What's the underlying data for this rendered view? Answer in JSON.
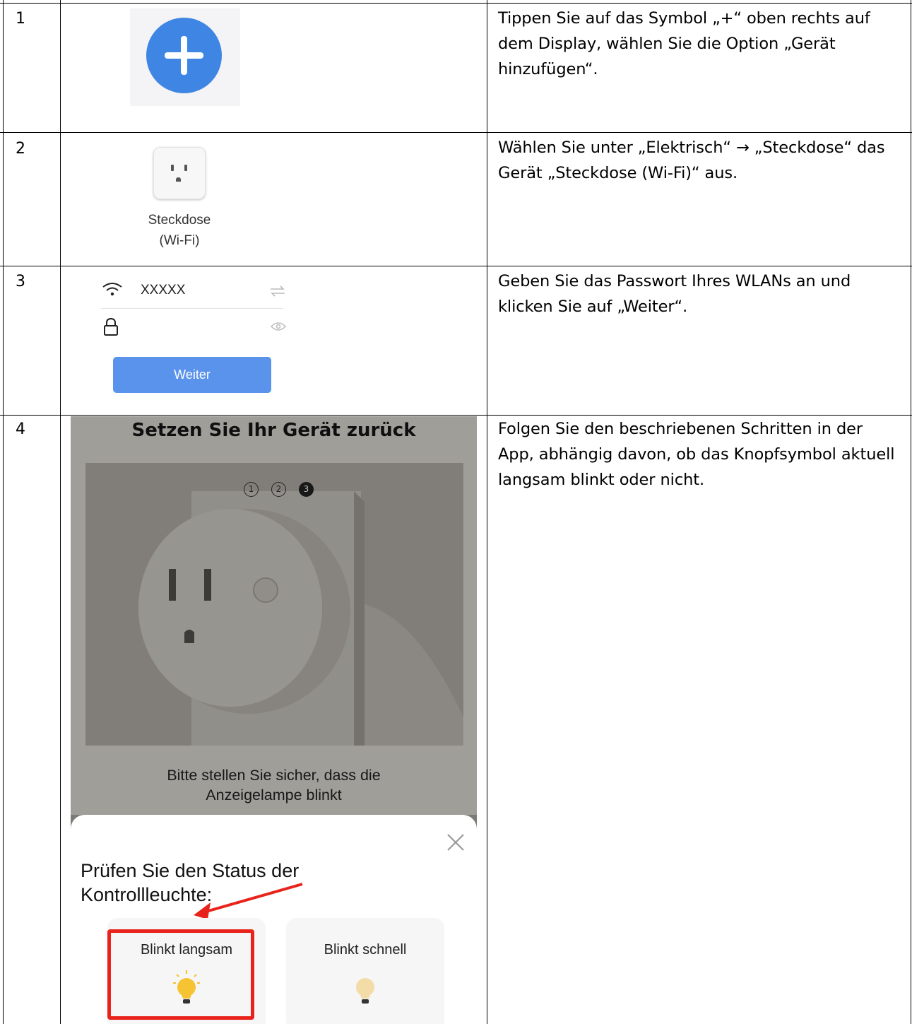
{
  "rows": [
    {
      "number": "1",
      "description": "Tippen Sie auf das Symbol „+“ oben rechts auf dem Display, wählen Sie die Option „Gerät hinzufügen“."
    },
    {
      "number": "2",
      "description": "Wählen Sie unter „Elektrisch“ → „Steckdose“ das Gerät „Steckdose (Wi-Fi)“ aus.",
      "device_label_line1": "Steckdose",
      "device_label_line2": "(Wi-Fi)"
    },
    {
      "number": "3",
      "description": "Geben Sie das Passwort Ihres WLANs an und klicken Sie auf „Weiter“.",
      "ssid": "XXXXX",
      "button_label": "Weiter"
    },
    {
      "number": "4",
      "description": "Folgen Sie den beschriebenen Schritten in der App, abhängig davon, ob das Knopfsymbol aktuell langsam blinkt oder nicht.",
      "app_title": "Setzen Sie Ihr Gerät zurück",
      "steps": [
        "1",
        "2",
        "3"
      ],
      "hint_line1": "Bitte stellen Sie sicher, dass die",
      "hint_line2": "Anzeigelampe blinkt",
      "sheet_title_line1": "Prüfen Sie den Status der",
      "sheet_title_line2": "Kontrollleuchte:",
      "option_slow": "Blinkt langsam",
      "option_fast": "Blinkt schnell"
    }
  ],
  "colors": {
    "plus_button": "#3f86e4",
    "weiter_button": "#5a93ec",
    "highlight": "#e8231b",
    "bulb_lit": "#f6c333",
    "bulb_dim": "#f3dca8"
  }
}
